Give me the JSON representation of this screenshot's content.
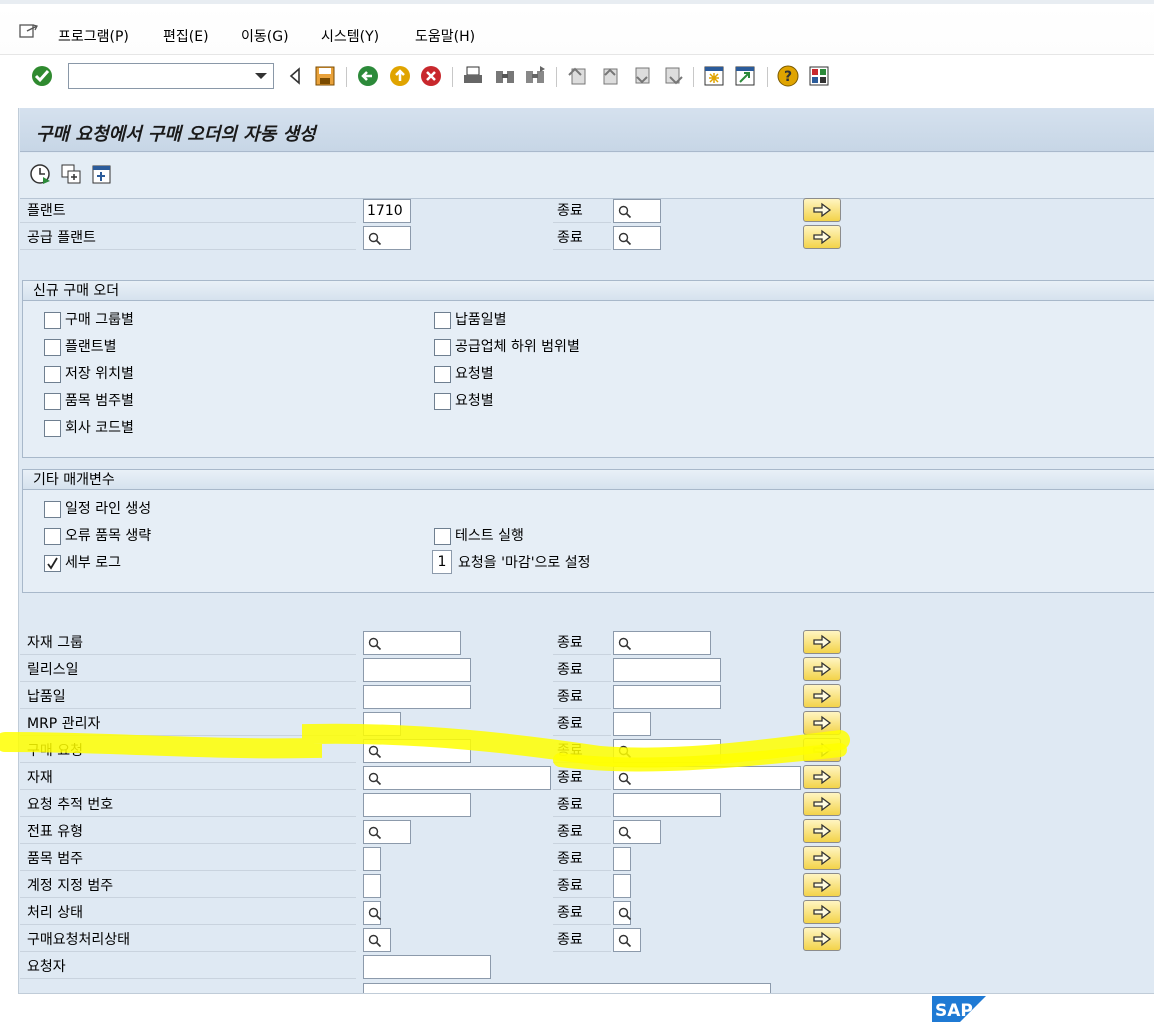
{
  "menu": {
    "items": [
      "프로그램(P)",
      "편집(E)",
      "이동(G)",
      "시스템(Y)",
      "도움말(H)"
    ]
  },
  "toolbar": {
    "command_field_value": ""
  },
  "page_title": "구매 요청에서 구매 오더의 자동 생성",
  "top_fields": [
    {
      "label": "플랜트",
      "from": "1710",
      "to_label": "종료",
      "to": ""
    },
    {
      "label": "공급 플랜트",
      "from": "",
      "to_label": "종료",
      "to": ""
    }
  ],
  "group_new_po": {
    "title": "신규 구매 오더",
    "left": [
      {
        "label": "구매 그룹별",
        "checked": false
      },
      {
        "label": "플랜트별",
        "checked": false
      },
      {
        "label": "저장 위치별",
        "checked": false
      },
      {
        "label": "품목 범주별",
        "checked": false
      },
      {
        "label": "회사 코드별",
        "checked": false
      }
    ],
    "right": [
      {
        "label": "납품일별",
        "checked": false
      },
      {
        "label": "공급업체 하위 범위별",
        "checked": false
      },
      {
        "label": "요청별",
        "checked": false
      },
      {
        "label": "요청별",
        "checked": false
      }
    ]
  },
  "group_other": {
    "title": "기타 매개변수",
    "schedule_line": {
      "label": "일정 라인 생성",
      "checked": false
    },
    "skip_error": {
      "label": "오류 품목 생략",
      "checked": false
    },
    "detail_log": {
      "label": "세부 로그",
      "checked": true
    },
    "test_run": {
      "label": "테스트 실행",
      "checked": false
    },
    "close_req_value": "1",
    "close_req_label": "요청을 '마감'으로 설정"
  },
  "selection_fields": [
    {
      "label": "자재 그룹",
      "to_label": "종료"
    },
    {
      "label": "릴리스일",
      "to_label": "종료"
    },
    {
      "label": "납품일",
      "to_label": "종료"
    },
    {
      "label": "MRP 관리자",
      "to_label": "종료"
    },
    {
      "label": "구매 요청",
      "to_label": "종료"
    },
    {
      "label": "자재",
      "to_label": "종료"
    },
    {
      "label": "요청 추적 번호",
      "to_label": "종료"
    },
    {
      "label": "전표 유형",
      "to_label": "종료"
    },
    {
      "label": "품목 범주",
      "to_label": "종료"
    },
    {
      "label": "계정 지정 범주",
      "to_label": "종료"
    },
    {
      "label": "처리 상태",
      "to_label": "종료"
    },
    {
      "label": "구매요청처리상태",
      "to_label": "종료"
    },
    {
      "label": "요청자",
      "to_label": ""
    }
  ],
  "colors": {
    "highlight": "#ffff00",
    "multi_button": "#f3d34a",
    "content_bg": "#dfe9f3"
  },
  "logo": "SAP"
}
